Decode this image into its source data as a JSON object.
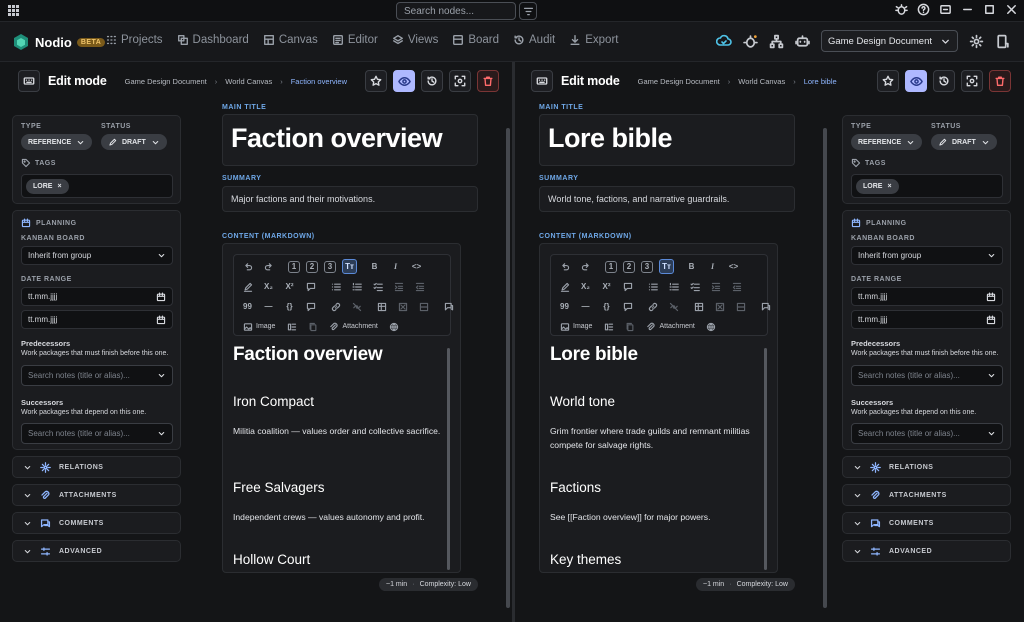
{
  "titlebar": {
    "search_placeholder": "Search nodes..."
  },
  "app": {
    "name": "Nodio",
    "badge": "BETA"
  },
  "nav": {
    "items": [
      {
        "label": "Projects",
        "icon": "grid-icon"
      },
      {
        "label": "Dashboard",
        "icon": "dashboard-icon"
      },
      {
        "label": "Canvas",
        "icon": "canvas-icon"
      },
      {
        "label": "Editor",
        "icon": "editor-icon"
      },
      {
        "label": "Views",
        "icon": "layers-icon"
      },
      {
        "label": "Board",
        "icon": "board-icon"
      },
      {
        "label": "Audit",
        "icon": "history-icon"
      },
      {
        "label": "Export",
        "icon": "download-icon"
      }
    ],
    "document_selector": "Game Design Document"
  },
  "panes": [
    {
      "edit_mode": "Edit mode",
      "breadcrumbs": [
        "Game Design Document",
        "World Canvas",
        "Faction overview"
      ],
      "meta": {
        "type_label": "TYPE",
        "type_value": "REFERENCE",
        "status_label": "STATUS",
        "status_value": "DRAFT",
        "tags_label": "TAGS",
        "tag": "LORE"
      },
      "planning": {
        "title": "PLANNING",
        "kanban_label": "KANBAN BOARD",
        "kanban_value": "Inherit from group",
        "date_label": "DATE RANGE",
        "date_start": "tt.mm.jjjj",
        "date_end": "tt.mm.jjjj",
        "pred_title": "Predecessors",
        "pred_desc": "Work packages that must finish before this one.",
        "pred_placeholder": "Search notes (title or alias)...",
        "succ_title": "Successors",
        "succ_desc": "Work packages that depend on this one.",
        "succ_placeholder": "Search notes (title or alias)..."
      },
      "sections": [
        "RELATIONS",
        "ATTACHMENTS",
        "COMMENTS",
        "ADVANCED"
      ],
      "main_title_label": "MAIN TITLE",
      "title": "Faction overview",
      "summary_label": "SUMMARY",
      "summary": "Major factions and their motivations.",
      "content_label": "CONTENT (MARKDOWN)",
      "content": {
        "h1": "Faction overview",
        "h2a": "Iron Compact",
        "p1": "Militia coalition — values order and collective sacrifice.",
        "h2b": "Free Salvagers",
        "p2": "Independent crews — values autonomy and profit.",
        "h2c": "Hollow Court"
      },
      "footer": {
        "time": "~1 min",
        "complexity": "Complexity: Low"
      }
    },
    {
      "edit_mode": "Edit mode",
      "breadcrumbs": [
        "Game Design Document",
        "World Canvas",
        "Lore bible"
      ],
      "meta": {
        "type_label": "TYPE",
        "type_value": "REFERENCE",
        "status_label": "STATUS",
        "status_value": "DRAFT",
        "tags_label": "TAGS",
        "tag": "LORE"
      },
      "planning": {
        "title": "PLANNING",
        "kanban_label": "KANBAN BOARD",
        "kanban_value": "Inherit from group",
        "date_label": "DATE RANGE",
        "date_start": "tt.mm.jjjj",
        "date_end": "tt.mm.jjjj",
        "pred_title": "Predecessors",
        "pred_desc": "Work packages that must finish before this one.",
        "pred_placeholder": "Search notes (title or alias)...",
        "succ_title": "Successors",
        "succ_desc": "Work packages that depend on this one.",
        "succ_placeholder": "Search notes (title or alias)..."
      },
      "sections": [
        "RELATIONS",
        "ATTACHMENTS",
        "COMMENTS",
        "ADVANCED"
      ],
      "main_title_label": "MAIN TITLE",
      "title": "Lore bible",
      "summary_label": "SUMMARY",
      "summary": "World tone, factions, and narrative guardrails.",
      "content_label": "CONTENT (MARKDOWN)",
      "content": {
        "h1": "Lore bible",
        "h2a": "World tone",
        "p1": "Grim frontier where trade guilds and remnant militias compete for salvage rights.",
        "h2b": "Factions",
        "p2": "See [[Faction overview]] for major powers.",
        "h2c": "Key themes"
      },
      "footer": {
        "time": "~1 min",
        "complexity": "Complexity: Low"
      }
    }
  ],
  "toolbar": {
    "image_label": "Image",
    "attachment_label": "Attachment",
    "text_style_glyph": "Tт",
    "bold": "B",
    "italic": "I",
    "code": "<>",
    "quote": "99",
    "block": "{}",
    "subscript": "X₂",
    "superscript": "X²"
  }
}
